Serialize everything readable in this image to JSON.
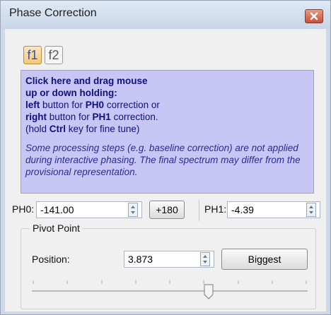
{
  "window": {
    "title": "Phase Correction"
  },
  "tabs": [
    {
      "label": "f1",
      "active": true
    },
    {
      "label": "f2",
      "active": false
    }
  ],
  "info": {
    "line1": "Click here and drag mouse",
    "line2": "up or down holding:",
    "line3_bold": "left",
    "line3_rest": " button for ",
    "line3_bold2": "PH0",
    "line3_end": " correction or",
    "line4_bold": "right",
    "line4_rest": " button for ",
    "line4_bold2": "PH1",
    "line4_end": " correction.",
    "line5_start": "(hold ",
    "line5_bold": "Ctrl",
    "line5_end": " key for fine tune)",
    "note": "Some processing steps (e.g. baseline correction) are not applied during interactive phasing. The final spectrum may differ from the provisional representation."
  },
  "phase": {
    "ph0_label": "PH0:",
    "ph0_value": "-141.00",
    "plus180_label": "+180",
    "ph1_label": "PH1:",
    "ph1_value": "-4.39"
  },
  "pivot": {
    "group_title": "Pivot Point",
    "position_label": "Position:",
    "position_value": "3.873",
    "biggest_label": "Biggest",
    "slider_fraction": 0.64
  },
  "colors": {
    "info_bg": "#c7c6f4",
    "info_text": "#101080",
    "active_tab": "#f3c978",
    "close_button": "#c8503a"
  }
}
